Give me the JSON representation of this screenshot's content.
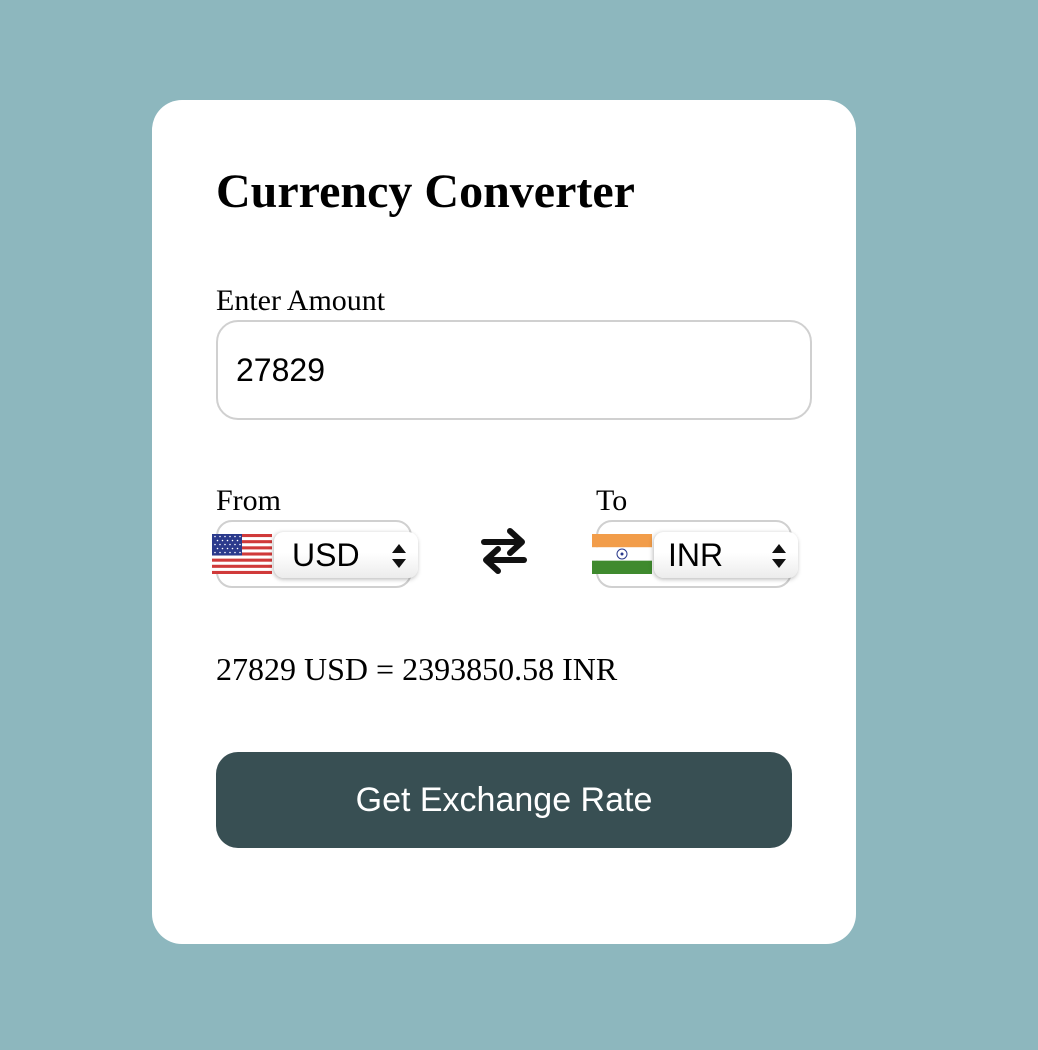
{
  "converter": {
    "title": "Currency Converter",
    "amount_label": "Enter Amount",
    "amount_value": "27829",
    "from_label": "From",
    "to_label": "To",
    "from_currency": "USD",
    "to_currency": "INR",
    "from_flag_icon": "us-flag-icon",
    "to_flag_icon": "india-flag-icon",
    "result_text": "27829 USD = 2393850.58 INR",
    "button_label": "Get Exchange Rate"
  },
  "colors": {
    "page_background": "#8db7be",
    "card_background": "#ffffff",
    "button_background": "#384f53",
    "button_text": "#ffffff"
  }
}
